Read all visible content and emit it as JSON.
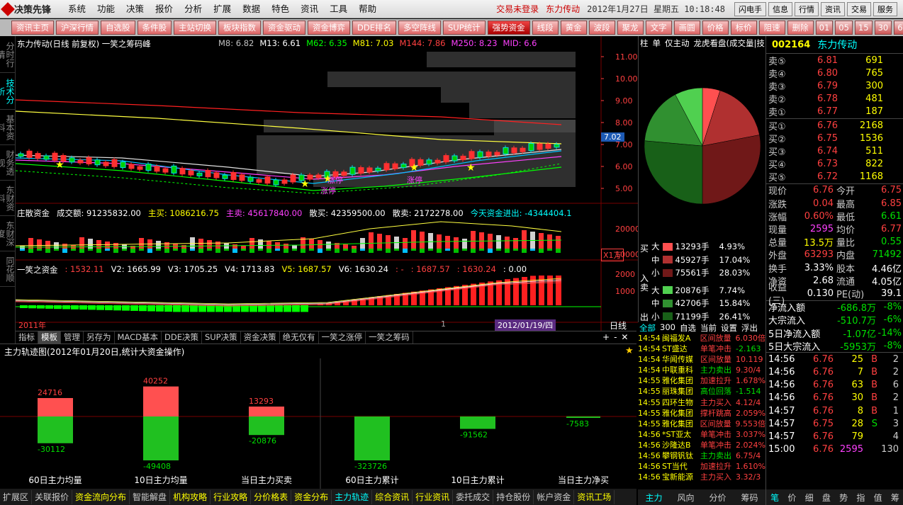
{
  "app": {
    "logo_text": "决策先锋",
    "menu": [
      "系统",
      "功能",
      "决策",
      "报价",
      "分析",
      "扩展",
      "数据",
      "特色",
      "资讯",
      "工具",
      "帮助"
    ],
    "login_status": "交易未登录",
    "stock_name": "东力传动",
    "datetime": "2012年1月27日 星期五 10:18:48",
    "right_buttons": [
      "闪电手",
      "信息",
      "行情",
      "资讯",
      "交易",
      "服务"
    ]
  },
  "toolbar": {
    "buttons": [
      "资讯主页",
      "沪深行情",
      "自选股",
      "条件股",
      "主站切换",
      "板块指数",
      "资金驱动",
      "资金博弈",
      "DDE排名",
      "多空阵线",
      "SUP统计",
      "强势资金",
      "线段",
      "黄金",
      "波段",
      "聚龙",
      "文字",
      "画圆",
      "价格",
      "标价",
      "阻速",
      "删除"
    ],
    "active": "强势资金",
    "periods": [
      "01",
      "05",
      "15",
      "30",
      "60",
      "多分"
    ]
  },
  "left_tabs": [
    "分时行情",
    "技术分析",
    "基本资料",
    "财务透视",
    "东财资料",
    "东财深度",
    "同花顺"
  ],
  "chart": {
    "title": "东力传动(日线 前复权) 一笑之筹码峰",
    "ma": [
      {
        "label": "M8: 6.82",
        "color": "#c0c0c0"
      },
      {
        "label": "M13: 6.61",
        "color": "#ffffff"
      },
      {
        "label": "M62: 6.35",
        "color": "#00ff00"
      },
      {
        "label": "M81: 7.03",
        "color": "#ffff00"
      },
      {
        "label": "M144: 7.86",
        "color": "#ff4040"
      },
      {
        "label": "M250: 8.23",
        "color": "#ff40ff"
      },
      {
        "label": "MID: 6.6",
        "color": "#ff40ff"
      }
    ],
    "price_axis": [
      "11.00",
      "10.00",
      "9.00",
      "8.00",
      "7.00",
      "6.00",
      "5.00"
    ],
    "current_price_tag": "7.02",
    "annotations": [
      "涨停",
      "涨停",
      "涨停"
    ],
    "fund_header": {
      "label": "庄散资金",
      "volume": "成交额: 91235832.00",
      "zhumai": "主买: 1086216.75",
      "zhumai_out": "主卖: 45617840.00",
      "sanmai": "散买: 42359500.00",
      "sanmai_out": "散卖: 2172278.00",
      "today": "今天资金进出: -4344404.1"
    },
    "fund_axis": [
      "20000",
      "10000"
    ],
    "fund_unit": "X1万",
    "v_header": {
      "label": "一笑之资金",
      "v1": ": 1532.11",
      "v2": "V2: 1665.99",
      "v3": "V3: 1705.25",
      "v4": "V4: 1713.83",
      "v5": "V5: 1687.57",
      "v6": "V6: 1630.24",
      "x1": ": -",
      "x2": ": 1687.57",
      "x3": ": 1630.24",
      "x4": ": 0.00"
    },
    "v_axis": [
      "2000",
      "1000"
    ],
    "date_left": "2011年",
    "date_mid": "1",
    "date_cursor": "2012/01/19/四",
    "period_label": "日线"
  },
  "bottom_tabs": [
    "指标",
    "模板",
    "管理",
    "另存为",
    "MACD基本",
    "DDE决策",
    "SUP决策",
    "资金决策",
    "绝无仅有",
    "一笑之涨停",
    "一笑之筹码"
  ],
  "bottom_tabs_active": "模板",
  "lower": {
    "title": "主力轨迹图(2012年01月20日,统计大资金操作)",
    "bars": [
      {
        "label": "60日主力均量",
        "top": "24716",
        "bottom": "-30112",
        "top_v": 24716,
        "bot_v": 30112
      },
      {
        "label": "10日主力均量",
        "top": "40252",
        "bottom": "-49408",
        "top_v": 40252,
        "bot_v": 49408
      },
      {
        "label": "当日主力买卖",
        "top": "13293",
        "bottom": "-20876",
        "top_v": 13293,
        "bot_v": 20876
      },
      {
        "label": "60日主力累计",
        "top": "",
        "bottom": "-323726",
        "top_v": 0,
        "bot_v": 323726
      },
      {
        "label": "10日主力累计",
        "top": "",
        "bottom": "-91562",
        "top_v": 0,
        "bot_v": 91562
      },
      {
        "label": "当日主力净买",
        "top": "",
        "bottom": "-7583",
        "top_v": 0,
        "bot_v": 7583
      }
    ]
  },
  "bottom_bar": {
    "items": [
      {
        "label": "扩展区",
        "c": ""
      },
      {
        "label": "关联报价",
        "c": ""
      },
      {
        "label": "资金流向分布",
        "c": "y"
      },
      {
        "label": "智能解盘",
        "c": ""
      },
      {
        "label": "机构攻略",
        "c": "y"
      },
      {
        "label": "行业攻略",
        "c": "y"
      },
      {
        "label": "分价格表",
        "c": "y"
      },
      {
        "label": "资金分布",
        "c": "y"
      },
      {
        "label": "主力轨迹",
        "c": "c"
      },
      {
        "label": "综合资讯",
        "c": "y"
      },
      {
        "label": "行业资讯",
        "c": "y"
      },
      {
        "label": "委托成交",
        "c": ""
      },
      {
        "label": "持仓股份",
        "c": ""
      },
      {
        "label": "帐户资金",
        "c": ""
      },
      {
        "label": "资讯工场",
        "c": "y"
      }
    ]
  },
  "pie_panel": {
    "tabs": [
      "柱",
      "单",
      "仅主动",
      "龙虎看盘(成交量|技"
    ],
    "buy_label": "买",
    "in_label": "入",
    "sell_label": "卖",
    "out_label": "出",
    "rows": [
      {
        "side": "大",
        "val": "13293手",
        "pct": "4.93%",
        "color": "#ff5050"
      },
      {
        "side": "中",
        "val": "45927手",
        "pct": "17.04%",
        "color": "#b03030"
      },
      {
        "side": "小",
        "val": "75561手",
        "pct": "28.03%",
        "color": "#701818"
      },
      {
        "side": "大",
        "val": "20876手",
        "pct": "7.74%",
        "color": "#50d050"
      },
      {
        "side": "中",
        "val": "42706手",
        "pct": "15.84%",
        "color": "#309030"
      },
      {
        "side": "小",
        "val": "71199手",
        "pct": "26.41%",
        "color": "#186018"
      }
    ],
    "pie_values": [
      4.93,
      17.04,
      28.03,
      26.41,
      15.84,
      7.74
    ]
  },
  "news": {
    "tabs": [
      "全部",
      "300",
      "自选",
      "当前",
      "设置",
      "浮出"
    ],
    "rows": [
      {
        "t": "14:54",
        "n": "闽福发A",
        "e": "区间放量",
        "v": "6.030倍"
      },
      {
        "t": "14:54",
        "n": "ST盛达",
        "e": "单笔冲击",
        "v": "-2.163"
      },
      {
        "t": "14:54",
        "n": "华闻传媒",
        "e": "区间放量",
        "v": "10.119"
      },
      {
        "t": "14:54",
        "n": "中联重科",
        "e": "主力卖出",
        "v": "9.30/4"
      },
      {
        "t": "14:55",
        "n": "雅化集团",
        "e": "加速拉升",
        "v": "1.678%"
      },
      {
        "t": "14:55",
        "n": "丽珠集团",
        "e": "高位回落",
        "v": "-1.514"
      },
      {
        "t": "14:55",
        "n": "四环生物",
        "e": "主力买入",
        "v": "4.12/4"
      },
      {
        "t": "14:55",
        "n": "雅化集团",
        "e": "撑杆跳高",
        "v": "2.059%"
      },
      {
        "t": "14:55",
        "n": "雅化集团",
        "e": "区间放量",
        "v": "9.553倍"
      },
      {
        "t": "14:56",
        "n": "*ST亚太",
        "e": "单笔冲击",
        "v": "3.037%"
      },
      {
        "t": "14:56",
        "n": "沙隆达B",
        "e": "单笔冲击",
        "v": "2.024%"
      },
      {
        "t": "14:56",
        "n": "攀钢钒钛",
        "e": "主力卖出",
        "v": "6.75/4"
      },
      {
        "t": "14:56",
        "n": "ST当代",
        "e": "加速拉升",
        "v": "1.610%"
      },
      {
        "t": "14:56",
        "n": "宝新能源",
        "e": "主力买入",
        "v": "3.32/3"
      }
    ],
    "bottom_tabs": [
      "主力",
      "风向",
      "分价",
      "筹码"
    ]
  },
  "quote": {
    "code": "002164",
    "name": "东力传动",
    "sell": [
      {
        "l": "卖⑤",
        "p": "6.81",
        "v": "691"
      },
      {
        "l": "卖④",
        "p": "6.80",
        "v": "765"
      },
      {
        "l": "卖③",
        "p": "6.79",
        "v": "300"
      },
      {
        "l": "卖②",
        "p": "6.78",
        "v": "481"
      },
      {
        "l": "卖①",
        "p": "6.77",
        "v": "187"
      }
    ],
    "buy": [
      {
        "l": "买①",
        "p": "6.76",
        "v": "2168"
      },
      {
        "l": "买②",
        "p": "6.75",
        "v": "1536"
      },
      {
        "l": "买③",
        "p": "6.74",
        "v": "511"
      },
      {
        "l": "买④",
        "p": "6.73",
        "v": "822"
      },
      {
        "l": "买⑤",
        "p": "6.72",
        "v": "1168"
      }
    ],
    "stats": [
      {
        "a": "现价",
        "av": "6.76",
        "ac": "r",
        "b": "今开",
        "bv": "6.75",
        "bc": "r"
      },
      {
        "a": "涨跌",
        "av": "0.04",
        "ac": "r",
        "b": "最高",
        "bv": "6.85",
        "bc": "r"
      },
      {
        "a": "涨幅",
        "av": "0.60%",
        "ac": "r",
        "b": "最低",
        "bv": "6.61",
        "bc": "g"
      },
      {
        "a": "现量",
        "av": "2595",
        "ac": "m",
        "b": "均价",
        "bv": "6.77",
        "bc": "r"
      },
      {
        "a": "总量",
        "av": "13.5万",
        "ac": "y",
        "b": "量比",
        "bv": "0.55",
        "bc": "g"
      },
      {
        "a": "外盘",
        "av": "63293",
        "ac": "r",
        "b": "内盘",
        "bv": "71492",
        "bc": "g"
      },
      {
        "a": "换手",
        "av": "3.33%",
        "ac": "w",
        "b": "股本",
        "bv": "4.46亿",
        "bc": "w"
      },
      {
        "a": "净资",
        "av": "2.68",
        "ac": "w",
        "b": "流通",
        "bv": "4.05亿",
        "bc": "w"
      },
      {
        "a": "收益(三)",
        "av": "0.130",
        "ac": "w",
        "b": "PE(动)",
        "bv": "39.1",
        "bc": "w"
      }
    ],
    "flows": [
      {
        "l": "净流入额",
        "v": "-686.8万",
        "p": "-8%"
      },
      {
        "l": "大宗流入",
        "v": "-510.7万",
        "p": "-6%"
      },
      {
        "l": "5日净流入额",
        "v": "-1.07亿",
        "p": "-14%"
      },
      {
        "l": "5日大宗流入",
        "v": "-5953万",
        "p": "-8%"
      }
    ],
    "ticks": [
      {
        "t": "14:56",
        "p": "6.76",
        "v": "25",
        "s": "B",
        "x": "2"
      },
      {
        "t": "14:56",
        "p": "6.76",
        "v": "7",
        "s": "B",
        "x": "2"
      },
      {
        "t": "14:56",
        "p": "6.76",
        "v": "63",
        "s": "B",
        "x": "6"
      },
      {
        "t": "14:56",
        "p": "6.76",
        "v": "30",
        "s": "B",
        "x": "2"
      },
      {
        "t": "14:57",
        "p": "6.76",
        "v": "8",
        "s": "B",
        "x": "1"
      },
      {
        "t": "14:57",
        "p": "6.75",
        "v": "28",
        "s": "S",
        "x": "3"
      },
      {
        "t": "14:57",
        "p": "6.76",
        "v": "79",
        "s": "",
        "x": "4"
      },
      {
        "t": "15:00",
        "p": "6.76",
        "v": "2595",
        "s": "",
        "x": "130"
      }
    ],
    "bottom_tabs": [
      "笔",
      "价",
      "细",
      "盘",
      "势",
      "指",
      "值",
      "筹"
    ]
  }
}
